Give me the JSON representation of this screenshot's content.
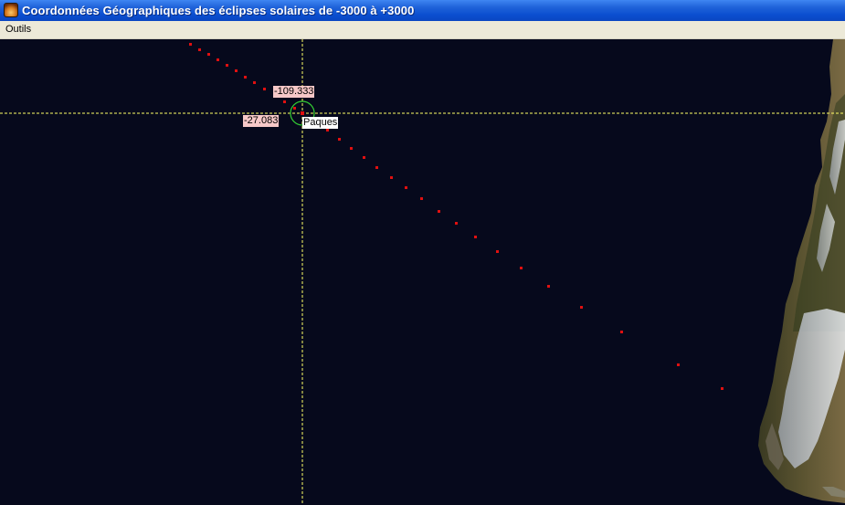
{
  "window": {
    "title": "Coordonnées Géographiques des éclipses solaires de -3000 à +3000",
    "icon": "eclipse-app-icon"
  },
  "menu": {
    "items": [
      {
        "label": "Outils"
      }
    ]
  },
  "map": {
    "longitude_label": "-109.333",
    "latitude_label": "-27.083",
    "place_label": "Paques",
    "crosshair_color": "#ffff66",
    "marker_color": "#33cc33",
    "eclipse_path_color": "#e01010"
  }
}
